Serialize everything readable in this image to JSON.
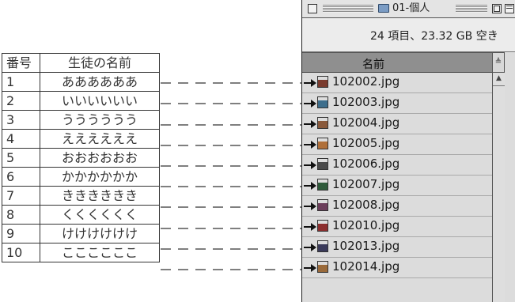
{
  "table": {
    "headers": [
      "番号",
      "生徒の名前"
    ],
    "rows": [
      {
        "no": "1",
        "name": "ああああああ"
      },
      {
        "no": "2",
        "name": "いいいいいい"
      },
      {
        "no": "3",
        "name": "うううううう"
      },
      {
        "no": "4",
        "name": "ええええええ"
      },
      {
        "no": "5",
        "name": "おおおおおお"
      },
      {
        "no": "6",
        "name": "かかかかかか"
      },
      {
        "no": "7",
        "name": "きききききき"
      },
      {
        "no": "8",
        "name": "くくくくくく"
      },
      {
        "no": "9",
        "name": "けけけけけけ"
      },
      {
        "no": "10",
        "name": "ここここここ"
      }
    ]
  },
  "window": {
    "title": "01-個人",
    "info": "24 項目、23.32 GB 空き",
    "column_header": "名前",
    "sort_glyph": "≜",
    "scroll_up_glyph": "▲",
    "files": [
      {
        "name": "102002.jpg",
        "color": "#7a3b2e"
      },
      {
        "name": "102003.jpg",
        "color": "#3d6e8c"
      },
      {
        "name": "102004.jpg",
        "color": "#8a5a3c"
      },
      {
        "name": "102005.jpg",
        "color": "#b0703a"
      },
      {
        "name": "102006.jpg",
        "color": "#4a4a4a"
      },
      {
        "name": "102007.jpg",
        "color": "#2e5a3a"
      },
      {
        "name": "102008.jpg",
        "color": "#6b3d5a"
      },
      {
        "name": "102010.jpg",
        "color": "#8c2e2e"
      },
      {
        "name": "102013.jpg",
        "color": "#3a3a5a"
      },
      {
        "name": "102014.jpg",
        "color": "#9a6a3a"
      }
    ]
  }
}
